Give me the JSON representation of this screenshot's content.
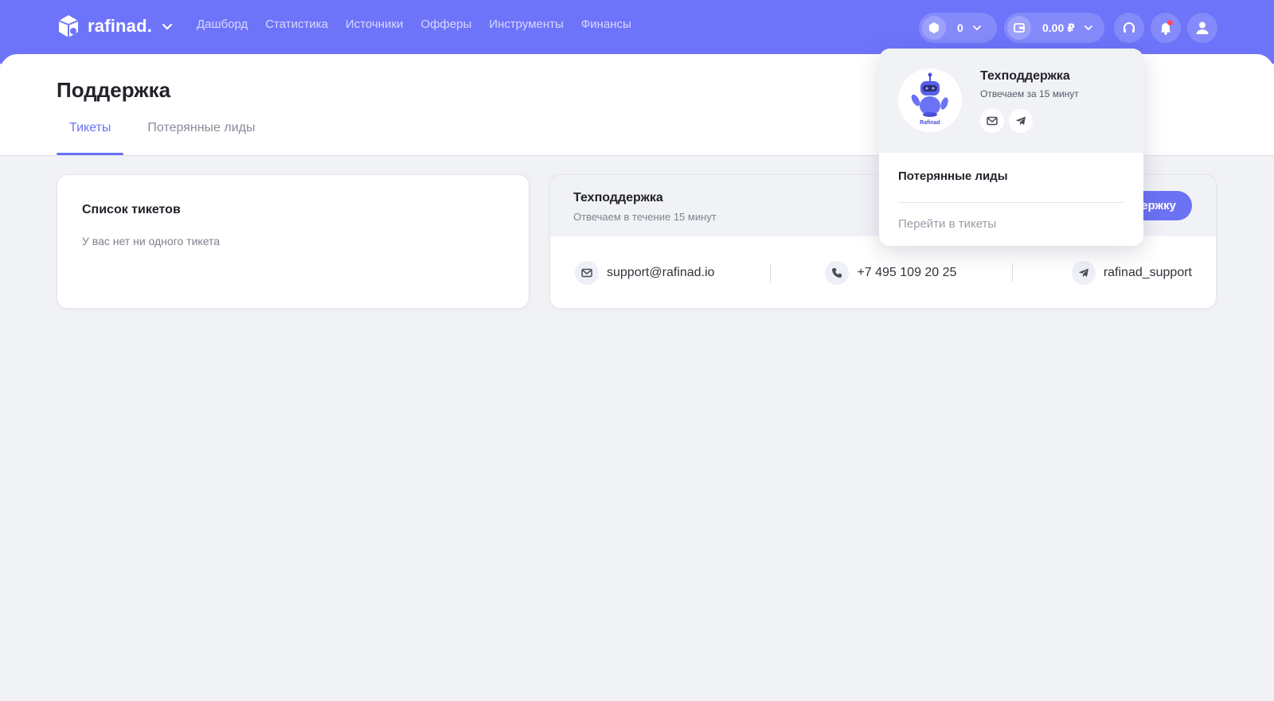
{
  "brand": {
    "name": "rafinad."
  },
  "nav": [
    {
      "label": "Дашборд"
    },
    {
      "label": "Статистика"
    },
    {
      "label": "Источники"
    },
    {
      "label": "Офферы"
    },
    {
      "label": "Инструменты"
    },
    {
      "label": "Финансы"
    }
  ],
  "topbar": {
    "points_value": "0",
    "balance_value": "0.00 ₽"
  },
  "page": {
    "title": "Поддержка",
    "tabs": [
      {
        "label": "Тикеты",
        "active": true
      },
      {
        "label": "Потерянные лиды",
        "active": false
      }
    ]
  },
  "tickets": {
    "title": "Список тикетов",
    "empty_text": "У вас нет ни одного тикета"
  },
  "support": {
    "title": "Техподдержка",
    "subtitle": "Отвечаем в течение 15 минут",
    "button_label": "ержку",
    "email": "support@rafinad.io",
    "phone": "+7 495 109 20 25",
    "telegram": "rafinad_support"
  },
  "dropdown": {
    "title": "Техподдержка",
    "subtitle": "Отвечаем за 15 минут",
    "avatar_label": "Rafinad",
    "item_lost_leads": "Потерянные лиды",
    "item_go_tickets": "Перейти в тикеты"
  },
  "colors": {
    "brand": "#6e74f9",
    "accent": "#6b72f4",
    "notification": "#ff4d5e"
  }
}
